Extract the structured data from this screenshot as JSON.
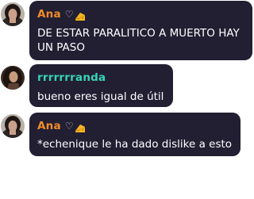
{
  "colors": {
    "bubble_bg": "#221f33",
    "text": "#ffffff",
    "name_ana": "#f28c28",
    "name_rrr": "#37d3b4"
  },
  "messages": [
    {
      "author": "Ana",
      "name_color": "#f28c28",
      "badges": [
        "heart-outline-icon",
        "cheese-icon"
      ],
      "heart": "♡",
      "text": "DE ESTAR PARALITICO A MUERTO HAY UN PASO",
      "avatar": "avatar-dark-hair-woman"
    },
    {
      "author": "rrrrrrranda",
      "name_color": "#37d3b4",
      "badges": [],
      "text": "bueno eres igual de útil",
      "avatar": "avatar-long-hair-woman"
    },
    {
      "author": "Ana",
      "name_color": "#f28c28",
      "badges": [
        "heart-outline-icon",
        "cheese-icon"
      ],
      "heart": "♡",
      "text": "*echenique le ha dado dislike a esto",
      "avatar": "avatar-dark-hair-woman"
    }
  ]
}
